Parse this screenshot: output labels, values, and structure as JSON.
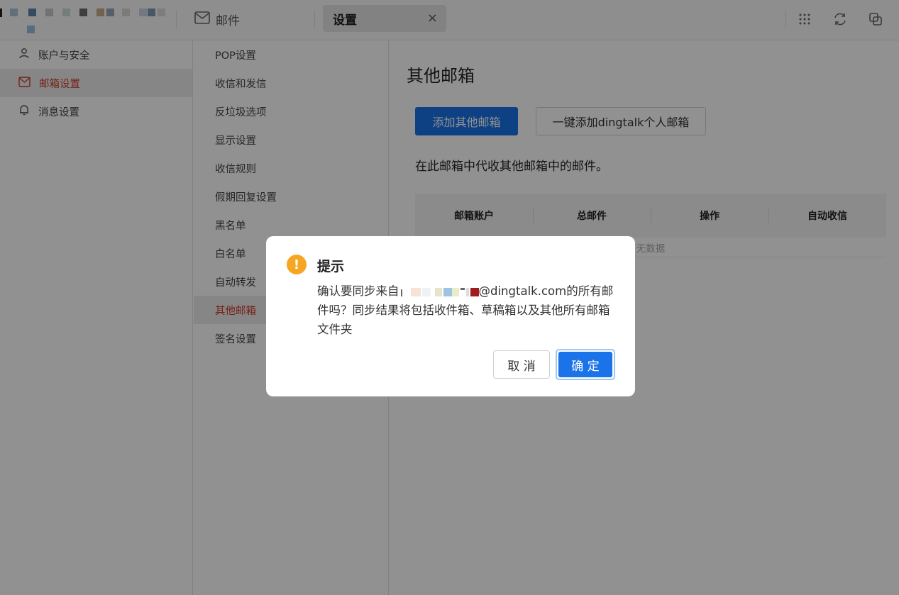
{
  "topbar": {
    "mail_tab_label": "邮件",
    "settings_tab_label": "设置",
    "close_glyph": "×"
  },
  "nav_primary": [
    {
      "label": "账户与安全",
      "icon": "user-icon",
      "active": false
    },
    {
      "label": "邮箱设置",
      "icon": "mail-settings-icon",
      "active": true
    },
    {
      "label": "消息设置",
      "icon": "bell-icon",
      "active": false
    }
  ],
  "nav_secondary": [
    {
      "label": "POP设置"
    },
    {
      "label": "收信和发信"
    },
    {
      "label": "反垃圾选项"
    },
    {
      "label": "显示设置"
    },
    {
      "label": "收信规则"
    },
    {
      "label": "假期回复设置"
    },
    {
      "label": "黑名单"
    },
    {
      "label": "白名单"
    },
    {
      "label": "自动转发"
    },
    {
      "label": "其他邮箱",
      "active": true
    },
    {
      "label": "签名设置"
    }
  ],
  "main": {
    "title": "其他邮箱",
    "add_button": "添加其他邮箱",
    "dingtalk_button": "一键添加dingtalk个人邮箱",
    "description": "在此邮箱中代收其他邮箱中的邮件。",
    "table": {
      "columns": [
        "邮箱账户",
        "总邮件",
        "操作",
        "自动收信"
      ],
      "empty_text": "无数据"
    }
  },
  "dialog": {
    "title": "提示",
    "icon": "warning-icon",
    "message_prefix": "确认要同步来自",
    "message_suffix": "@dingtalk.com的所有邮件吗？同步结果将包括收件箱、草稿箱以及其他所有邮箱文件夹",
    "cancel_label": "取 消",
    "confirm_label": "确 定"
  },
  "colors": {
    "primary": "#1a73e8",
    "active_nav": "#d03a2b",
    "warning": "#f5a623"
  }
}
